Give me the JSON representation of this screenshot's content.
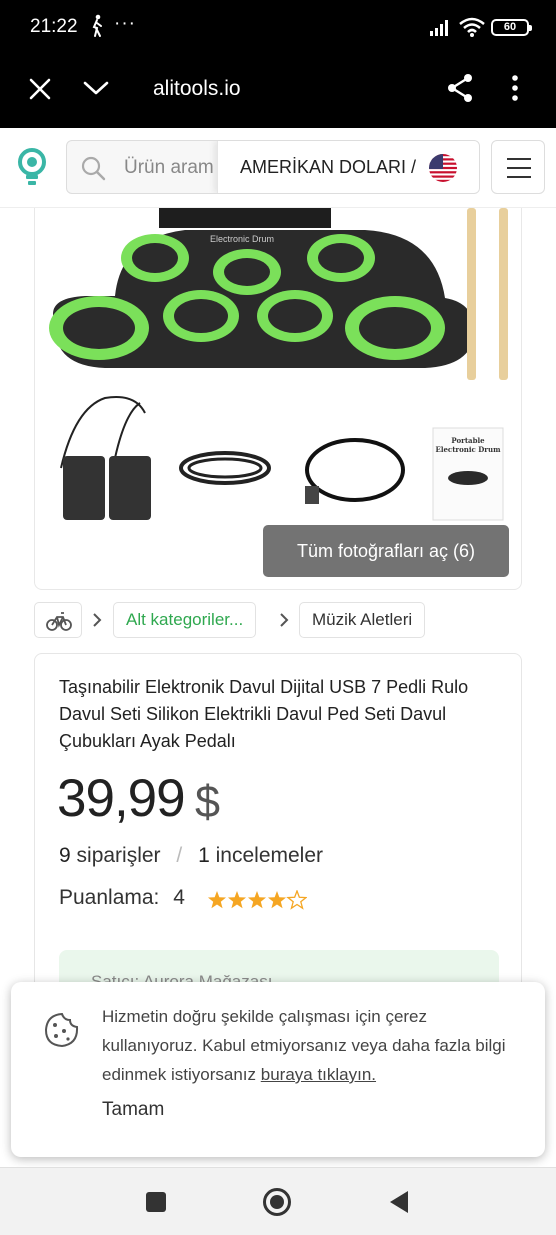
{
  "status_bar": {
    "time": "21:22",
    "more": "···",
    "battery": "60"
  },
  "browser": {
    "url": "alitools.io"
  },
  "header": {
    "search_placeholder": "Ürün aram",
    "currency_label": "AMERİKAN DOLARI /"
  },
  "gallery": {
    "drum_label": "Electronic Drum",
    "manual_title": "Portable Electronic Drum",
    "open_photos_button": "Tüm fotoğrafları aç (6)"
  },
  "breadcrumb": {
    "subcategories": "Alt kategoriler...",
    "category": "Müzik Aletleri"
  },
  "product": {
    "title": "Taşınabilir Elektronik Davul Dijital USB 7 Pedli Rulo Davul Seti Silikon Elektrikli Davul Ped Seti Davul Çubukları Ayak Pedalı",
    "price": "39,99",
    "currency": "$",
    "orders_count": "9",
    "orders_label": "siparişler",
    "separator": "/",
    "reviews_count": "1",
    "reviews_label": "incelemeler",
    "rating_label": "Puanlama:",
    "rating_value": "4",
    "rating_out_of_5": 4,
    "seller_partial": "Satıcı: Aurora Mağazası"
  },
  "cookie": {
    "message_main": "Hizmetin doğru şekilde çalışması için çerez kullanıyoruz. Kabul etmiyorsanız veya daha fazla bilgi edinmek istiyorsanız",
    "link_text": "buraya tıklayın.",
    "ok_button": "Tamam"
  },
  "colors": {
    "pad_green": "#7be05a",
    "star": "#f5a623",
    "accent_green": "#2fa84f",
    "logo_teal": "#3ab6a6"
  }
}
